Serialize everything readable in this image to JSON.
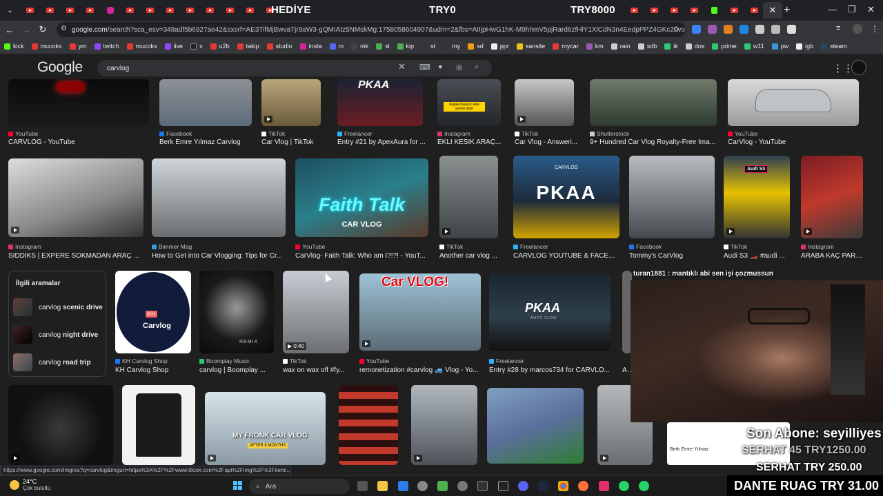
{
  "browser": {
    "overlay_words": [
      "HEDİYE",
      "TRY0",
      "TRY8000"
    ],
    "url_host": "google.com",
    "url_path": "/search?sca_esv=348adf5b6927ae42&sxsrf=AE3TifMjBwvaTjr9aW3-gQMIAtz5NMskMg:1758058604907&udm=2&fbs=AIIjpHwG1hK-M9hhmV5pjRard6zfHlY1XlCdN3n4EedpPPZ4GKc20voTBumvhe...",
    "status_url": "https://www.google.com/imgres?q=carvlog&imgurl=https%3A%2F%2Fwww.tiktok.com%2Fapi%2Fimg%2F%3Fitemi..."
  },
  "bookmarks": [
    "kick",
    "mucoks",
    "ym",
    "twitch",
    "mucoks",
    "live",
    "x",
    "u2b",
    "takip",
    "studio",
    "insta",
    "m",
    "mk",
    "sl",
    "kip",
    "st",
    "my",
    "sd",
    "ppr",
    "sansite",
    "mycar",
    "km",
    "rain",
    "sdb",
    "ik",
    "dos",
    "prime",
    "w11",
    "pw",
    "igb",
    "steam"
  ],
  "google": {
    "logo": "Google",
    "query": "carvlog"
  },
  "row1": [
    {
      "source": "YouTube",
      "title": "CARVLOG - YouTube"
    },
    {
      "source": "Facebook",
      "title": "Berk Emre Yılmaz Carvlog"
    },
    {
      "source": "TikTok",
      "title": "Car Vlog | TikTok"
    },
    {
      "source": "Freelancer",
      "title": "Entry #21 by ApexAura for ..."
    },
    {
      "source": "Instagram",
      "title": "EKLİ KESİK ARAÇ..."
    },
    {
      "source": "TikTok",
      "title": "Car Vlog - Answeri..."
    },
    {
      "source": "Shutterstock",
      "title": "9+ Hundred Car Vlog Royalty-Free Ima..."
    },
    {
      "source": "YouTube",
      "title": "CarVlog - YouTube"
    }
  ],
  "row1_labels": {
    "instagram_sticker": "başala havuzu arka paneli dahil"
  },
  "row2": [
    {
      "source": "Instagram",
      "title": "SIDDIKS | EXPERE SOKMADAN ARAÇ ..."
    },
    {
      "source": "Bimmer Mag",
      "title": "How to Get into Car Vlogging: Tips for Cr..."
    },
    {
      "source": "YouTube",
      "title": "CarVlog- Faith Talk: Who am I?!?! - YouT..."
    },
    {
      "source": "TikTok",
      "title": "Another car vlog ..."
    },
    {
      "source": "Freelancer",
      "title": "CARVLOG YOUTUBE & FACEB..."
    },
    {
      "source": "Facebook",
      "title": "Tommy's CarVlog"
    },
    {
      "source": "TikTok",
      "title": "Audi S3 🏎️ #audi ..."
    },
    {
      "source": "Instagram",
      "title": "ARABA KAÇ PARA..."
    }
  ],
  "row2_labels": {
    "faith": "Faith Talk",
    "faith_sub": "CAR VLOG",
    "pkaa": "PKAA",
    "pkaa_top": "CARVLOG",
    "audi": "Audi S3"
  },
  "related": {
    "heading": "İlgili aramalar",
    "items": [
      {
        "prefix": "carvlog",
        "bold": "scenic drive"
      },
      {
        "prefix": "carvlog",
        "bold": "night drive"
      },
      {
        "prefix": "carvlog",
        "bold": "road trip"
      }
    ]
  },
  "row3": [
    {
      "source": "KH Carvlog Shop",
      "title": "KH Carvlog Shop"
    },
    {
      "source": "Boomplay Music",
      "title": "carvlog | Boomplay ..."
    },
    {
      "source": "TikTok",
      "title": "wax on wax off #fy..."
    },
    {
      "source": "YouTube",
      "title": "remonetization #carvlog 🚙 Vlog - Yo..."
    },
    {
      "source": "Freelancer",
      "title": "Entry #28 by marcos734 for CARVLO..."
    },
    {
      "source": "",
      "title": "AIP..."
    }
  ],
  "row3_labels": {
    "kh_logo": "KH",
    "kh_name": "Carvlog",
    "remix": "REMIX",
    "duration": "0:40",
    "carvlog_big": "Car VLOG!",
    "pkaa2": "PKAA",
    "pkaa2_sub": "AUTO VLOG"
  },
  "row4_labels": {
    "fronk": "MY FRONK CAR VLOG",
    "fronk_sub": "AFTER 6 MONTHS",
    "mini": "Berk Emre Yılmaz"
  },
  "stream": {
    "chat_line": "turan1881 : mantıklı abi sen işi çozmussun",
    "last_sub": "Son Abone: seyilliyes",
    "donation_1": "SERHAT 45 TRY1250.00",
    "donation_2": "SERHAT TRY 250.00",
    "donation_bar": "DANTE RUAG TRY 31.00"
  },
  "taskbar": {
    "temp": "24°C",
    "weather": "Çok bulutlu",
    "search": "Ara"
  },
  "colors": {
    "youtube": "#ff0033",
    "facebook": "#1877f2",
    "tiktok": "#ffffff",
    "instagram": "#e1306c",
    "freelancer": "#29b2fe"
  }
}
